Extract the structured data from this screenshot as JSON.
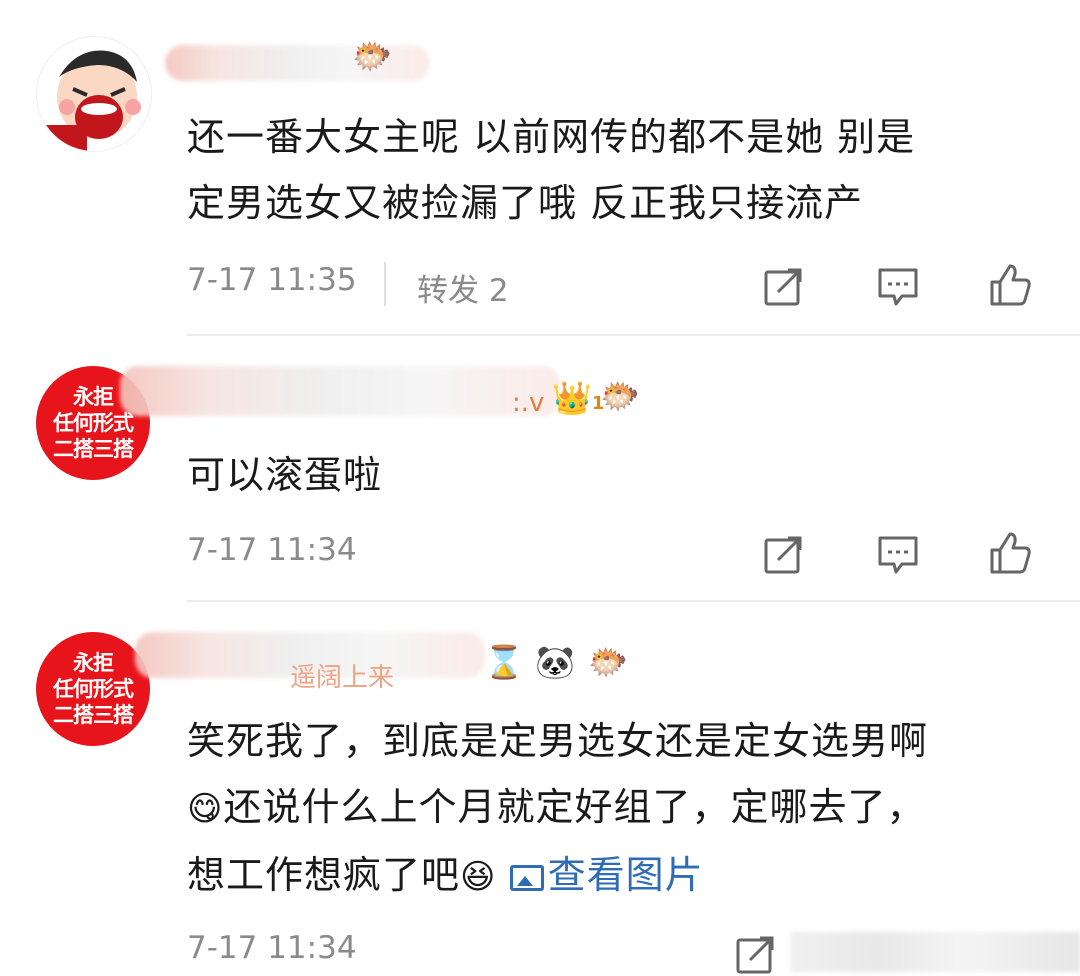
{
  "comments": [
    {
      "avatar_icon": "crying-child-avatar-icon",
      "badges": [
        "pufferfish-badge-icon"
      ],
      "text_line1": "还一番大女主呢 以前网传的都不是她 别是",
      "text_line2": "定男选女又被捡漏了哦 反正我只接流产",
      "time": "7-17 11:35",
      "repost_label": "转发 2"
    },
    {
      "avatar_text_line1": "永拒",
      "avatar_text_line2": "任何形式",
      "avatar_text_line3": "二搭三搭",
      "name_fragment": ":.v",
      "badges": [
        "crown-badge-icon",
        "pufferfish-badge-icon"
      ],
      "crown_level": "1",
      "text_line1": "可以滚蛋啦",
      "time": "7-17 11:34"
    },
    {
      "avatar_text_line1": "永拒",
      "avatar_text_line2": "任何形式",
      "avatar_text_line3": "二搭三搭",
      "name_fragment": "遥阔上来",
      "badges": [
        "hourglass-badge-icon",
        "panda-badge-icon",
        "pufferfish-badge-icon"
      ],
      "text_line1": "笑死我了，到底是定男选女还是定女选男啊",
      "text_line2": "还说什么上个月就定好组了，定哪去了，",
      "text_line3": "想工作想疯了吧",
      "emoji_tongue": "😋",
      "emoji_laugh": "😆",
      "image_link_label": "查看图片",
      "time": "7-17 11:34"
    }
  ],
  "icons": {
    "hourglass": "⌛",
    "panda": "🐼",
    "pufferfish": "🐡",
    "crown": "👑"
  },
  "colors": {
    "link": "#2f6cb5",
    "meta_text": "#8a8a8a",
    "avatar_red": "#e8141b",
    "body_text": "#1a1a1a"
  }
}
